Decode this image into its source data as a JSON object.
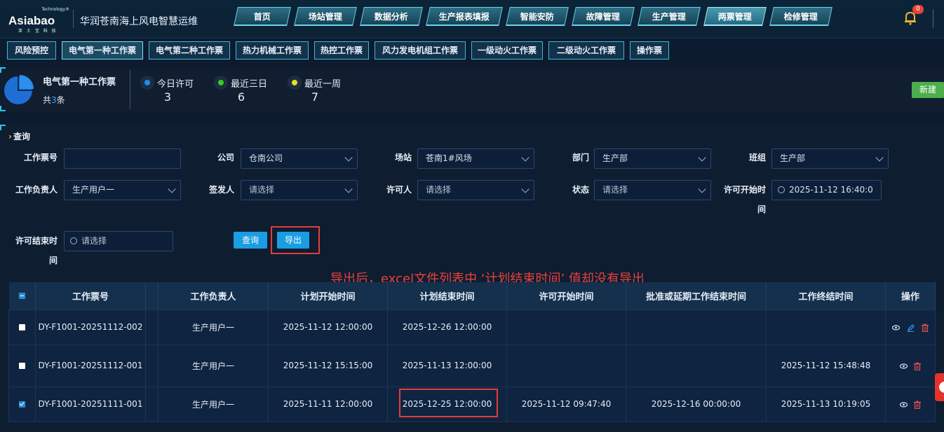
{
  "header": {
    "logo_tech": "Technology®",
    "logo_main": "Asiabao",
    "logo_sub": "亚 士 宝 科 技",
    "system_name": "华润苍南海上风电智慧运维",
    "nav": [
      "首页",
      "场站管理",
      "数据分析",
      "生产报表填报",
      "智能安防",
      "故障管理",
      "生产管理",
      "两票管理",
      "检修管理"
    ],
    "active_nav": "两票管理",
    "notification_count": "0"
  },
  "subtabs": {
    "items": [
      "风险预控",
      "电气第一种工作票",
      "电气第二种工作票",
      "热力机械工作票",
      "热控工作票",
      "风力发电机组工作票",
      "一级动火工作票",
      "二级动火工作票",
      "操作票"
    ],
    "active": "电气第一种工作票"
  },
  "summary": {
    "title": "电气第一种工作票",
    "count_prefix": "共",
    "count": "3",
    "count_suffix": "条",
    "stats": [
      {
        "label": "今日许可",
        "value": "3",
        "color": "#1e8cf0"
      },
      {
        "label": "最近三日",
        "value": "6",
        "color": "#33d11c"
      },
      {
        "label": "最近一周",
        "value": "7",
        "color": "#e3e31e"
      }
    ],
    "new_button": "新建"
  },
  "query": {
    "title": "查询",
    "ticket_no_label": "工作票号",
    "ticket_no_value": "",
    "company_label": "公司",
    "company_value": "仓南公司",
    "station_label": "场站",
    "station_value": "苍南1#风场",
    "dept_label": "部门",
    "dept_value": "生产部",
    "team_label": "班组",
    "team_value": "生产部",
    "leader_label": "工作负责人",
    "leader_value": "生产用户一",
    "issuer_label": "签发人",
    "issuer_placeholder": "请选择",
    "permitter_label": "许可人",
    "permitter_placeholder": "请选择",
    "status_label": "状态",
    "status_placeholder": "请选择",
    "permit_start_label_1": "许可开始时",
    "permit_start_label_2": "间",
    "permit_start_value": "2025-11-12 16:40:0",
    "permit_end_label_1": "许可结束时",
    "permit_end_label_2": "间",
    "permit_end_placeholder": "请选择",
    "search_button": "查询",
    "export_button": "导出"
  },
  "annotation": "导出后，excel文件列表中 ‘计划结束时间’ 值却没有导出",
  "table": {
    "columns": [
      "工作票号",
      "工作负责人",
      "计划开始时间",
      "计划结束时间",
      "许可开始时间",
      "批准或延期工作结束时间",
      "工作终结时间",
      "操作"
    ],
    "rows": [
      {
        "checked": false,
        "ticket": "DY-F1001-20251112-002",
        "leader": "生产用户一",
        "plan_start": "2025-11-12 12:00:00",
        "plan_end": "2025-12-26 12:00:00",
        "permit_start": "",
        "approved_end": "",
        "finish": "",
        "actions": [
          "eye-icon",
          "edit-icon",
          "delete-icon"
        ]
      },
      {
        "checked": false,
        "ticket": "DY-F1001-20251112-001",
        "leader": "生产用户一",
        "plan_start": "2025-11-12 15:15:00",
        "plan_end": "2025-11-13 12:00:00",
        "permit_start": "",
        "approved_end": "",
        "finish": "2025-11-12 15:48:48",
        "actions": [
          "eye-icon",
          "delete-icon"
        ]
      },
      {
        "checked": true,
        "ticket": "DY-F1001-20251111-001",
        "leader": "生产用户一",
        "plan_start": "2025-11-11 12:00:00",
        "plan_end": "2025-12-25 12:00:00",
        "permit_start": "2025-11-12 09:47:40",
        "approved_end": "2025-12-16 00:00:00",
        "finish": "2025-11-13 10:19:05",
        "actions": [
          "eye-icon",
          "delete-icon"
        ]
      }
    ]
  }
}
